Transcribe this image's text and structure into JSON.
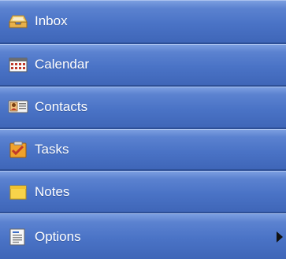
{
  "nav": {
    "items": [
      {
        "label": "Inbox",
        "icon": "inbox-icon"
      },
      {
        "label": "Calendar",
        "icon": "calendar-icon"
      },
      {
        "label": "Contacts",
        "icon": "contacts-icon"
      },
      {
        "label": "Tasks",
        "icon": "tasks-icon"
      },
      {
        "label": "Notes",
        "icon": "notes-icon"
      },
      {
        "label": "Options",
        "icon": "options-icon",
        "has_submenu": true
      }
    ]
  }
}
